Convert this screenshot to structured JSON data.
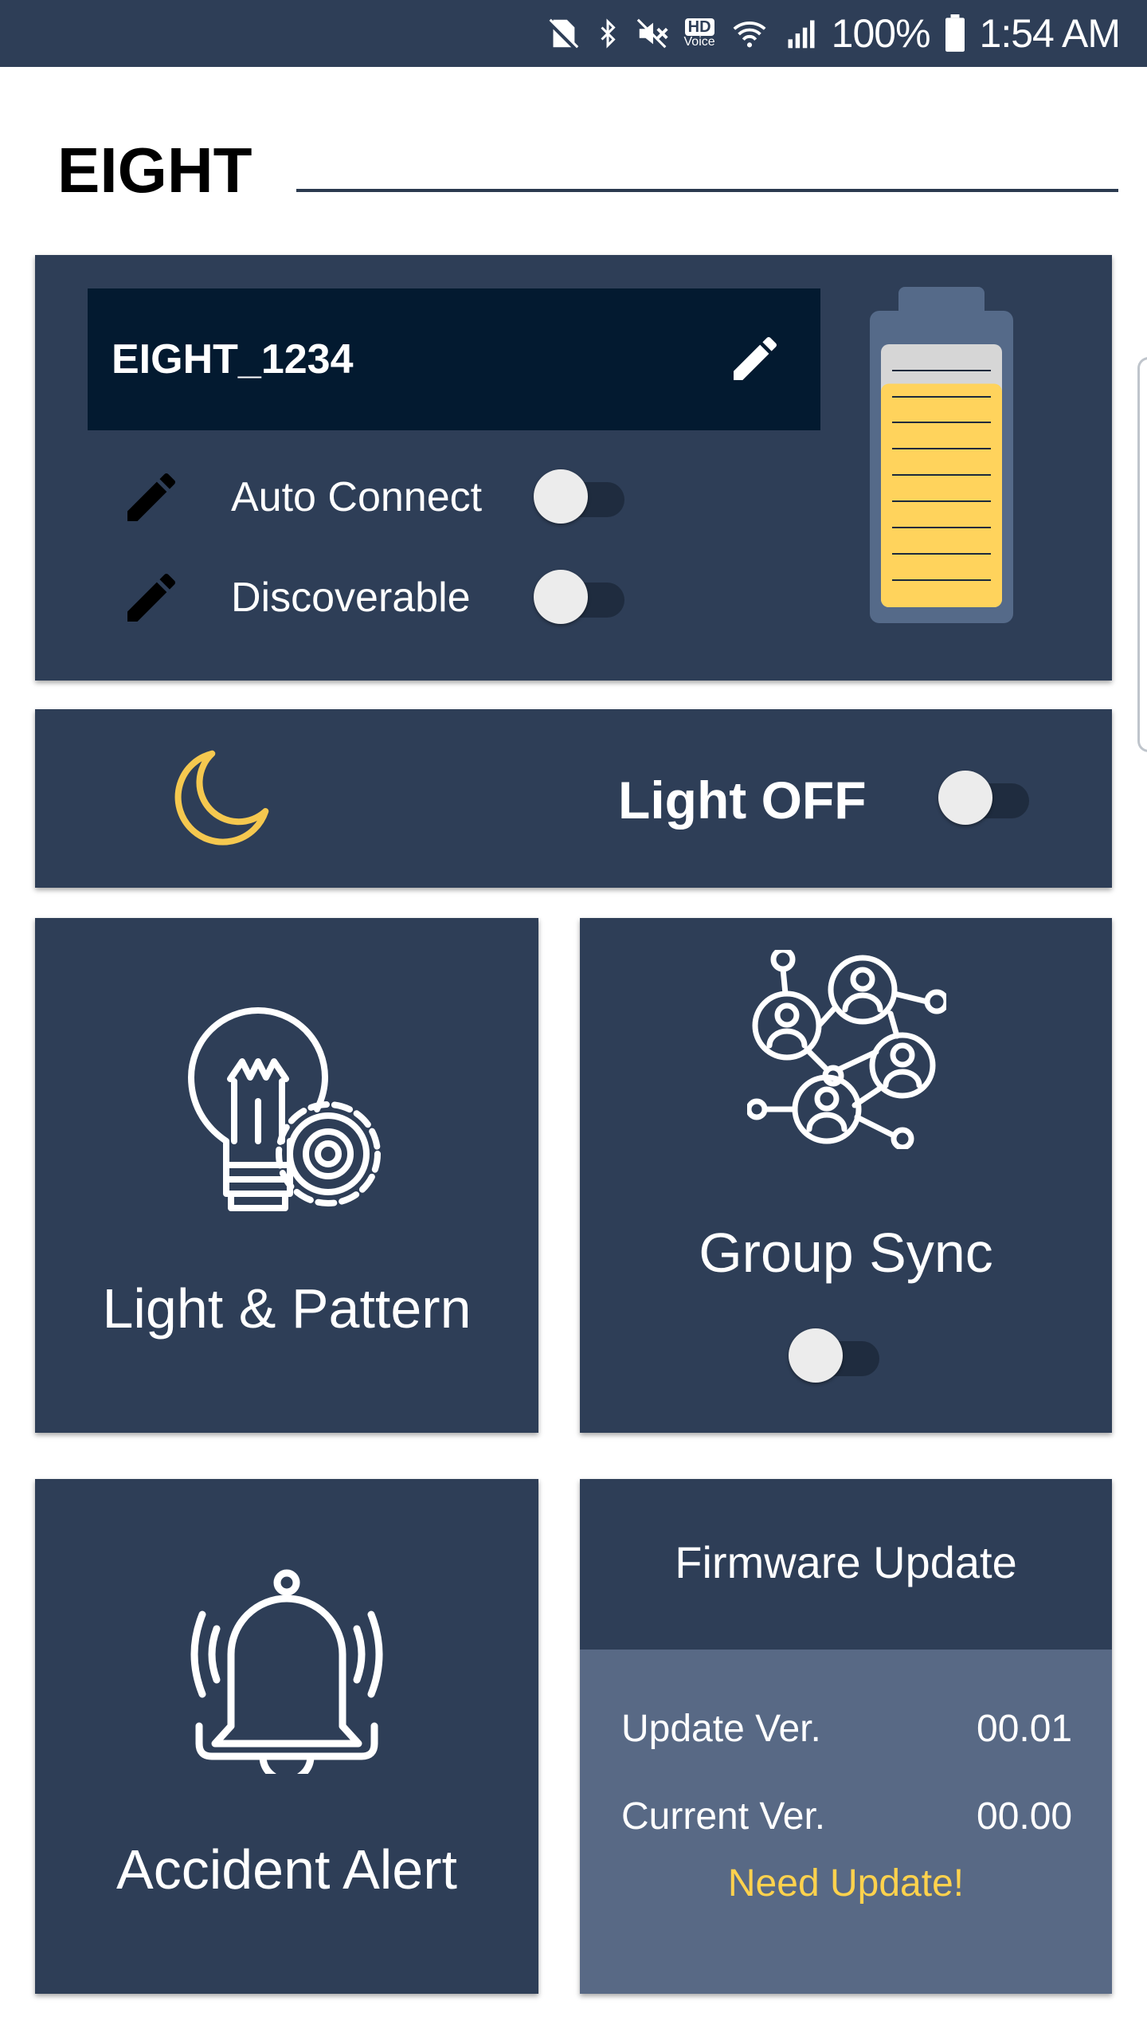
{
  "status_bar": {
    "battery_pct": "100%",
    "time": "1:54 AM",
    "hd_voice": "HD",
    "hd_voice_sub": "Voice",
    "icons": [
      "no-sim-icon",
      "bluetooth-icon",
      "mute-icon",
      "hd-voice-icon",
      "wifi-icon",
      "signal-icon",
      "battery-icon"
    ]
  },
  "header": {
    "brand": "EIGHT"
  },
  "device_card": {
    "device_name": "EIGHT_1234",
    "battery_level": 0.85,
    "auto_connect": {
      "label": "Auto Connect",
      "on": false
    },
    "discoverable": {
      "label": "Discoverable",
      "on": false
    }
  },
  "light_card": {
    "label": "Light OFF",
    "on": false
  },
  "tiles": {
    "light_pattern": {
      "label": "Light & Pattern"
    },
    "group_sync": {
      "label": "Group Sync",
      "on": false
    },
    "accident_alert": {
      "label": "Accident Alert"
    }
  },
  "firmware": {
    "title": "Firmware Update",
    "update_label": "Update Ver.",
    "update_value": "00.01",
    "current_label": "Current Ver.",
    "current_value": "00.00",
    "status": "Need Update!"
  },
  "colors": {
    "card_bg": "#2e3e57",
    "name_bg": "#031a30",
    "accent_yellow": "#ffd24d",
    "firmware_lower": "#586985"
  }
}
